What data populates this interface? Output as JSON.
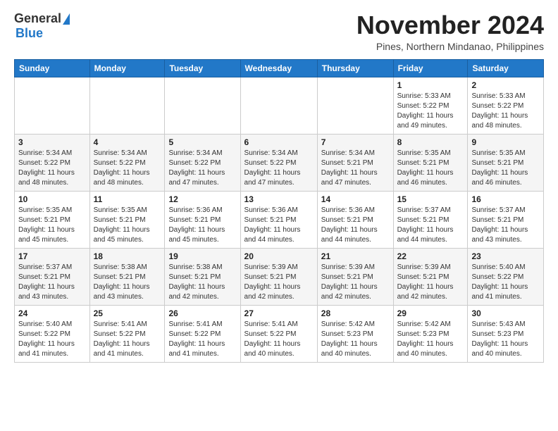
{
  "logo": {
    "general": "General",
    "blue": "Blue"
  },
  "title": {
    "month_year": "November 2024",
    "location": "Pines, Northern Mindanao, Philippines"
  },
  "weekdays": [
    "Sunday",
    "Monday",
    "Tuesday",
    "Wednesday",
    "Thursday",
    "Friday",
    "Saturday"
  ],
  "weeks": [
    [
      {
        "day": "",
        "info": ""
      },
      {
        "day": "",
        "info": ""
      },
      {
        "day": "",
        "info": ""
      },
      {
        "day": "",
        "info": ""
      },
      {
        "day": "",
        "info": ""
      },
      {
        "day": "1",
        "info": "Sunrise: 5:33 AM\nSunset: 5:22 PM\nDaylight: 11 hours\nand 49 minutes."
      },
      {
        "day": "2",
        "info": "Sunrise: 5:33 AM\nSunset: 5:22 PM\nDaylight: 11 hours\nand 48 minutes."
      }
    ],
    [
      {
        "day": "3",
        "info": "Sunrise: 5:34 AM\nSunset: 5:22 PM\nDaylight: 11 hours\nand 48 minutes."
      },
      {
        "day": "4",
        "info": "Sunrise: 5:34 AM\nSunset: 5:22 PM\nDaylight: 11 hours\nand 48 minutes."
      },
      {
        "day": "5",
        "info": "Sunrise: 5:34 AM\nSunset: 5:22 PM\nDaylight: 11 hours\nand 47 minutes."
      },
      {
        "day": "6",
        "info": "Sunrise: 5:34 AM\nSunset: 5:22 PM\nDaylight: 11 hours\nand 47 minutes."
      },
      {
        "day": "7",
        "info": "Sunrise: 5:34 AM\nSunset: 5:21 PM\nDaylight: 11 hours\nand 47 minutes."
      },
      {
        "day": "8",
        "info": "Sunrise: 5:35 AM\nSunset: 5:21 PM\nDaylight: 11 hours\nand 46 minutes."
      },
      {
        "day": "9",
        "info": "Sunrise: 5:35 AM\nSunset: 5:21 PM\nDaylight: 11 hours\nand 46 minutes."
      }
    ],
    [
      {
        "day": "10",
        "info": "Sunrise: 5:35 AM\nSunset: 5:21 PM\nDaylight: 11 hours\nand 45 minutes."
      },
      {
        "day": "11",
        "info": "Sunrise: 5:35 AM\nSunset: 5:21 PM\nDaylight: 11 hours\nand 45 minutes."
      },
      {
        "day": "12",
        "info": "Sunrise: 5:36 AM\nSunset: 5:21 PM\nDaylight: 11 hours\nand 45 minutes."
      },
      {
        "day": "13",
        "info": "Sunrise: 5:36 AM\nSunset: 5:21 PM\nDaylight: 11 hours\nand 44 minutes."
      },
      {
        "day": "14",
        "info": "Sunrise: 5:36 AM\nSunset: 5:21 PM\nDaylight: 11 hours\nand 44 minutes."
      },
      {
        "day": "15",
        "info": "Sunrise: 5:37 AM\nSunset: 5:21 PM\nDaylight: 11 hours\nand 44 minutes."
      },
      {
        "day": "16",
        "info": "Sunrise: 5:37 AM\nSunset: 5:21 PM\nDaylight: 11 hours\nand 43 minutes."
      }
    ],
    [
      {
        "day": "17",
        "info": "Sunrise: 5:37 AM\nSunset: 5:21 PM\nDaylight: 11 hours\nand 43 minutes."
      },
      {
        "day": "18",
        "info": "Sunrise: 5:38 AM\nSunset: 5:21 PM\nDaylight: 11 hours\nand 43 minutes."
      },
      {
        "day": "19",
        "info": "Sunrise: 5:38 AM\nSunset: 5:21 PM\nDaylight: 11 hours\nand 42 minutes."
      },
      {
        "day": "20",
        "info": "Sunrise: 5:39 AM\nSunset: 5:21 PM\nDaylight: 11 hours\nand 42 minutes."
      },
      {
        "day": "21",
        "info": "Sunrise: 5:39 AM\nSunset: 5:21 PM\nDaylight: 11 hours\nand 42 minutes."
      },
      {
        "day": "22",
        "info": "Sunrise: 5:39 AM\nSunset: 5:21 PM\nDaylight: 11 hours\nand 42 minutes."
      },
      {
        "day": "23",
        "info": "Sunrise: 5:40 AM\nSunset: 5:22 PM\nDaylight: 11 hours\nand 41 minutes."
      }
    ],
    [
      {
        "day": "24",
        "info": "Sunrise: 5:40 AM\nSunset: 5:22 PM\nDaylight: 11 hours\nand 41 minutes."
      },
      {
        "day": "25",
        "info": "Sunrise: 5:41 AM\nSunset: 5:22 PM\nDaylight: 11 hours\nand 41 minutes."
      },
      {
        "day": "26",
        "info": "Sunrise: 5:41 AM\nSunset: 5:22 PM\nDaylight: 11 hours\nand 41 minutes."
      },
      {
        "day": "27",
        "info": "Sunrise: 5:41 AM\nSunset: 5:22 PM\nDaylight: 11 hours\nand 40 minutes."
      },
      {
        "day": "28",
        "info": "Sunrise: 5:42 AM\nSunset: 5:23 PM\nDaylight: 11 hours\nand 40 minutes."
      },
      {
        "day": "29",
        "info": "Sunrise: 5:42 AM\nSunset: 5:23 PM\nDaylight: 11 hours\nand 40 minutes."
      },
      {
        "day": "30",
        "info": "Sunrise: 5:43 AM\nSunset: 5:23 PM\nDaylight: 11 hours\nand 40 minutes."
      }
    ]
  ]
}
